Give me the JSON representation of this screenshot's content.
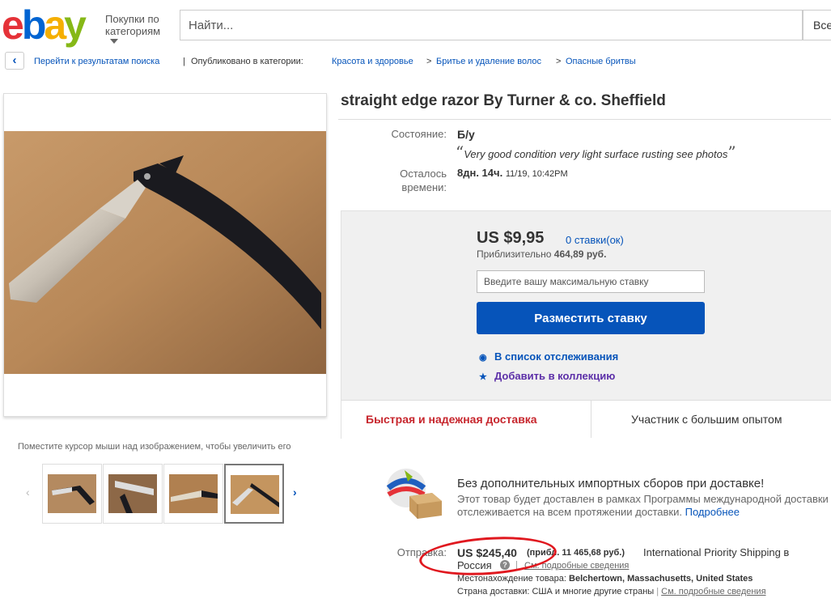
{
  "header": {
    "logo_letters": [
      "e",
      "b",
      "a",
      "y"
    ],
    "categories_label_1": "Покупки по",
    "categories_label_2": "категориям",
    "search_placeholder": "Найти...",
    "category_select": "Все"
  },
  "breadcrumb": {
    "back_link": "Перейти к результатам поиска",
    "published_in": "Опубликовано в категории:",
    "items": [
      "Красота и здоровье",
      "Бритье и удаление волос",
      "Опасные бритвы"
    ],
    "sep_pipe": "|",
    "sep_arrow": ">"
  },
  "gallery": {
    "hover_hint": "Поместите курсор мыши над изображением, чтобы увеличить его",
    "prev_icon": "chevron-left-icon",
    "next_icon": "chevron-right-icon",
    "thumb_count": 4,
    "selected_index": 3
  },
  "item": {
    "title": "straight edge razor By Turner & co. Sheffield",
    "condition_label": "Состояние:",
    "condition_value": "Б/у",
    "condition_desc": "Very good condition very light surface rusting see photos",
    "quote_open": "“",
    "quote_close": "”",
    "time_label_1": "Осталось",
    "time_label_2": "времени:",
    "time_left": "8дн. 14ч.",
    "end_date": "11/19, 10:42PM"
  },
  "bid": {
    "price": "US $9,95",
    "bids_link": "0 ставки(ок)",
    "approx_label": "Приблизительно",
    "approx_value": "464,89 руб.",
    "max_bid_placeholder": "Введите вашу максимальную ставку",
    "place_bid_button": "Разместить ставку",
    "watchlist": "В список отслеживания",
    "collection": "Добавить в коллекцию",
    "feature_1": "Быстрая и надежная доставка",
    "feature_2": "Участник с большим опытом"
  },
  "global_shipping": {
    "title": "Без дополнительных импортных сборов при доставке!",
    "text": "Этот товар будет доставлен в рамках Программы международной доставки и отслеживается на всем протяжении доставки.",
    "more_link": "Подробнее"
  },
  "shipping": {
    "label": "Отправка:",
    "price": "US $245,40",
    "approx": "(прибл. 11 465,68 руб.)",
    "method": "International Priority Shipping в",
    "destination": "Россия",
    "help_icon": "?",
    "sep": "|",
    "details_link": "См. подробные сведения",
    "location_label": "Местонахождение товара:",
    "location_value": "Belchertown, Massachusetts, United States",
    "dest_label": "Страна доставки:",
    "dest_value": "США и многие другие страны",
    "dest_details_link": "См. подробные сведения"
  },
  "colors": {
    "primary_blue": "#0654ba",
    "feature_red": "#c7262d",
    "annotation_red": "#e0181f"
  }
}
